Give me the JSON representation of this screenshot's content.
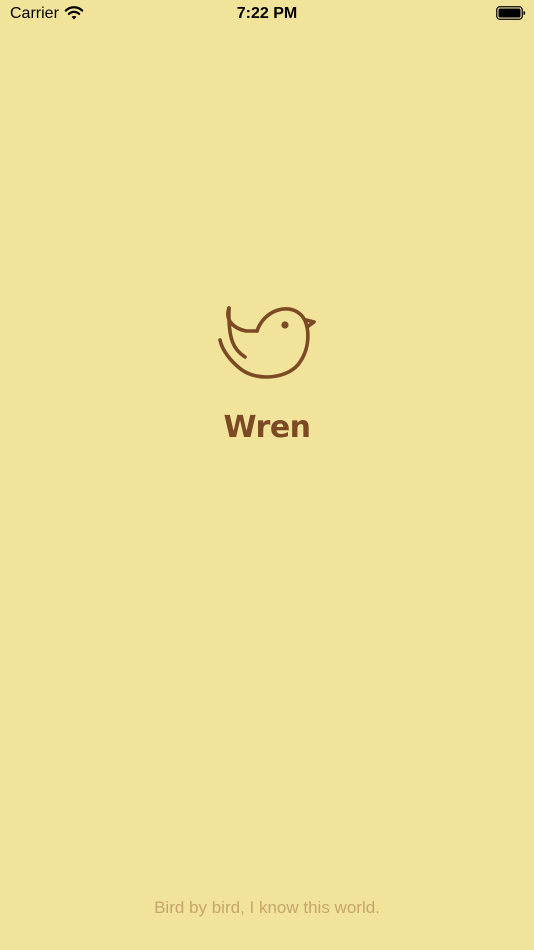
{
  "status_bar": {
    "carrier": "Carrier",
    "time": "7:22 PM"
  },
  "splash": {
    "app_name": "Wren",
    "tagline": "Bird by bird, I know this world."
  },
  "colors": {
    "background": "#f2e39b",
    "brand": "#7b4a24",
    "tagline": "#c6a56c"
  },
  "icons": {
    "wifi": "wifi-icon",
    "battery": "battery-icon",
    "logo": "bird-logo-icon"
  }
}
